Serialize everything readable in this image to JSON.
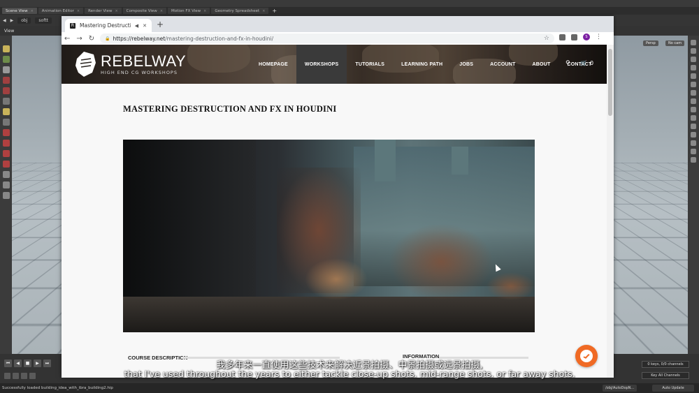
{
  "houdini": {
    "tabs": [
      {
        "label": "Scene View"
      },
      {
        "label": "Animation Editor"
      },
      {
        "label": "Render View"
      },
      {
        "label": "Composite View"
      },
      {
        "label": "Motion FX View"
      },
      {
        "label": "Geometry Spreadsheet"
      }
    ],
    "path": {
      "obj": "obj",
      "node": "softt"
    },
    "view_label": "View",
    "persp": "Persp",
    "cam": "No cam",
    "timeline": {
      "frame_start": "1",
      "frame_current": "1",
      "frame_end_a": "240",
      "frame_end_b": "240"
    },
    "keys_info": "0 keys, 0/0 channels",
    "key_all": "Key All Channels",
    "status": "Successfully loaded building_idea_with_ibra_building2.hip",
    "net_path": "/obj/AutoDopN...",
    "auto_update": "Auto Update"
  },
  "browser": {
    "tab_title": "Mastering Destruction a",
    "favicon": "R",
    "new_tab": "+",
    "url_host": "https://rebelway.net",
    "url_path": "/mastering-destruction-and-fx-in-houdini/",
    "avatar": "S"
  },
  "site": {
    "logo": "REBELWAY",
    "tagline": "HIGH END CG WORKSHOPS",
    "nav": [
      {
        "label": "HOMEPAGE"
      },
      {
        "label": "WORKSHOPS"
      },
      {
        "label": "TUTORIALS"
      },
      {
        "label": "LEARNING PATH"
      },
      {
        "label": "JOBS"
      },
      {
        "label": "ACCOUNT"
      },
      {
        "label": "ABOUT"
      },
      {
        "label": "CONTACT"
      }
    ],
    "cart_count": "0",
    "page_title": "MASTERING DESTRUCTION AND FX IN HOUDINI",
    "course_description": "COURSE DESCRIPTION",
    "information": "INFORMATION"
  },
  "subtitles": {
    "cn": "我多年来一直使用这些技术来解决近景拍摄、中景拍摄或远景拍摄,",
    "en": "that I've used throughout the years to either tackle close-up shots. mid-range shots. or far away shots."
  }
}
